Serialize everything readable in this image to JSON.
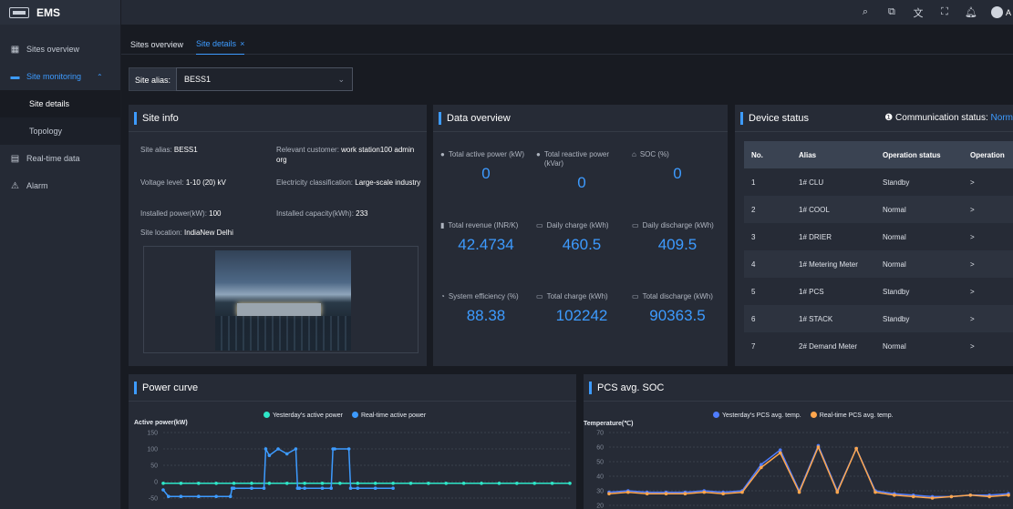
{
  "app": {
    "name": "EMS",
    "user_initials": "A"
  },
  "sidebar": {
    "items": [
      {
        "label": "Sites overview",
        "icon": "grid-icon"
      },
      {
        "label": "Site monitoring",
        "icon": "monitor-icon",
        "expanded": true
      },
      {
        "label": "Real-time data",
        "icon": "database-icon"
      },
      {
        "label": "Alarm",
        "icon": "alarm-icon"
      }
    ],
    "sub_items": [
      {
        "label": "Site details",
        "selected": true
      },
      {
        "label": "Topology"
      }
    ]
  },
  "tabs": [
    {
      "label": "Sites overview"
    },
    {
      "label": "Site details",
      "active": true,
      "close": "×"
    }
  ],
  "alias_select": {
    "label": "Site alias:",
    "value": "BESS1"
  },
  "site_info": {
    "title": "Site info",
    "fields": {
      "alias": {
        "label": "Site alias:",
        "value": "BESS1"
      },
      "customer": {
        "label": "Relevant customer:",
        "value": "work station100 admin org"
      },
      "voltage": {
        "label": "Voltage level:",
        "value": "1-10 (20) kV"
      },
      "elec_class": {
        "label": "Electricity classification:",
        "value": "Large-scale industry"
      },
      "installed_power": {
        "label": "Installed power(kW):",
        "value": "100"
      },
      "installed_capacity": {
        "label": "Installed capacity(kWh):",
        "value": "233"
      },
      "location": {
        "label": "Site location:",
        "value": "IndiaNew Delhi"
      }
    }
  },
  "data_overview": {
    "title": "Data overview",
    "metrics": [
      {
        "label": "Total active power (kW)",
        "value": "0"
      },
      {
        "label": "Total reactive power (kVar)",
        "value": "0"
      },
      {
        "label": "SOC (%)",
        "value": "0"
      },
      {
        "label": "Total revenue (INR/K)",
        "value": "42.4734"
      },
      {
        "label": "Daily charge (kWh)",
        "value": "460.5"
      },
      {
        "label": "Daily discharge (kWh)",
        "value": "409.5"
      },
      {
        "label": "System efficiency (%)",
        "value": "88.38"
      },
      {
        "label": "Total charge (kWh)",
        "value": "102242"
      },
      {
        "label": "Total discharge (kWh)",
        "value": "90363.5"
      }
    ]
  },
  "device_status": {
    "title": "Device status",
    "comm_label": "Communication status:",
    "comm_value": "Norm",
    "columns": [
      "No.",
      "Alias",
      "Operation status",
      "Operation"
    ],
    "rows": [
      {
        "no": "1",
        "alias": "1# CLU",
        "status": "Standby",
        "op": ">"
      },
      {
        "no": "2",
        "alias": "1# COOL",
        "status": "Normal",
        "op": ">"
      },
      {
        "no": "3",
        "alias": "1# DRIER",
        "status": "Normal",
        "op": ">"
      },
      {
        "no": "4",
        "alias": "1# Metering Meter",
        "status": "Normal",
        "op": ">"
      },
      {
        "no": "5",
        "alias": "1# PCS",
        "status": "Standby",
        "op": ">"
      },
      {
        "no": "6",
        "alias": "1# STACK",
        "status": "Standby",
        "op": ">"
      },
      {
        "no": "7",
        "alias": "2# Demand Meter",
        "status": "Normal",
        "op": ">"
      }
    ]
  },
  "power_curve": {
    "title": "Power curve",
    "legend": [
      "Yesterday's active power",
      "Real-time active power"
    ],
    "colors": {
      "yesterday": "#2ee6c8",
      "realtime": "#3d9bff"
    }
  },
  "pcs_soc": {
    "title": "PCS avg. SOC",
    "legend": [
      "Yesterday's PCS avg. temp.",
      "Real-time PCS avg. temp."
    ],
    "colors": {
      "yesterday": "#4f7dff",
      "realtime": "#ffa64d"
    }
  },
  "chart_data": [
    {
      "type": "line",
      "title": "Power curve",
      "ylabel": "Active power(kW)",
      "ylim": [
        -50,
        150
      ],
      "yticks": [
        "150",
        "100",
        "50",
        "0",
        "-50"
      ],
      "grid": true,
      "legend_position": "top-center",
      "series": [
        {
          "name": "Yesterday's active power",
          "x": [
            0,
            1,
            2,
            3,
            4,
            5,
            6,
            7,
            8,
            9,
            10,
            11,
            12,
            13,
            14,
            15,
            16,
            17,
            18,
            19,
            20,
            21,
            22,
            23
          ],
          "values": [
            -5,
            -5,
            -5,
            -5,
            -5,
            -5,
            -5,
            -5,
            -5,
            -5,
            -5,
            -5,
            -5,
            -5,
            -5,
            -5,
            -5,
            -5,
            -5,
            -5,
            -5,
            -5,
            -5,
            -5
          ]
        },
        {
          "name": "Real-time active power",
          "x": [
            0,
            0.3,
            1,
            2,
            3,
            3.8,
            3.9,
            4,
            5,
            5.7,
            5.8,
            6,
            6.5,
            7,
            7.5,
            7.6,
            7.7,
            8,
            9,
            9.5,
            9.6,
            9.7,
            10.5,
            10.6,
            11,
            12,
            13
          ],
          "values": [
            -25,
            -45,
            -45,
            -45,
            -45,
            -45,
            -20,
            -20,
            -20,
            -20,
            100,
            80,
            100,
            85,
            100,
            -20,
            -20,
            -20,
            -20,
            -20,
            100,
            100,
            100,
            -20,
            -20,
            -20,
            -20
          ]
        }
      ]
    },
    {
      "type": "line",
      "title": "PCS avg. SOC",
      "ylabel": "Temperature(℃)",
      "ylim": [
        20,
        70
      ],
      "yticks": [
        "70",
        "60",
        "50",
        "40",
        "30",
        "20"
      ],
      "grid": true,
      "legend_position": "top-center",
      "series": [
        {
          "name": "Yesterday's PCS avg. temp.",
          "x": [
            0,
            1,
            2,
            3,
            4,
            5,
            6,
            7,
            8,
            9,
            10,
            11,
            12,
            13,
            14,
            15,
            16,
            17,
            18,
            19,
            20,
            21
          ],
          "values": [
            29,
            30,
            29,
            29,
            29,
            30,
            29,
            30,
            48,
            58,
            30,
            61,
            30,
            59,
            30,
            28,
            27,
            26,
            26,
            27,
            27,
            28
          ]
        },
        {
          "name": "Real-time PCS avg. temp.",
          "x": [
            0,
            1,
            2,
            3,
            4,
            5,
            6,
            7,
            8,
            9,
            10,
            11,
            12,
            13,
            14,
            15,
            16,
            17,
            18,
            19,
            20,
            21
          ],
          "values": [
            28,
            29,
            28,
            28,
            28,
            29,
            28,
            29,
            46,
            56,
            29,
            60,
            29,
            59,
            29,
            27,
            26,
            25,
            26,
            27,
            26,
            27
          ]
        }
      ]
    }
  ]
}
